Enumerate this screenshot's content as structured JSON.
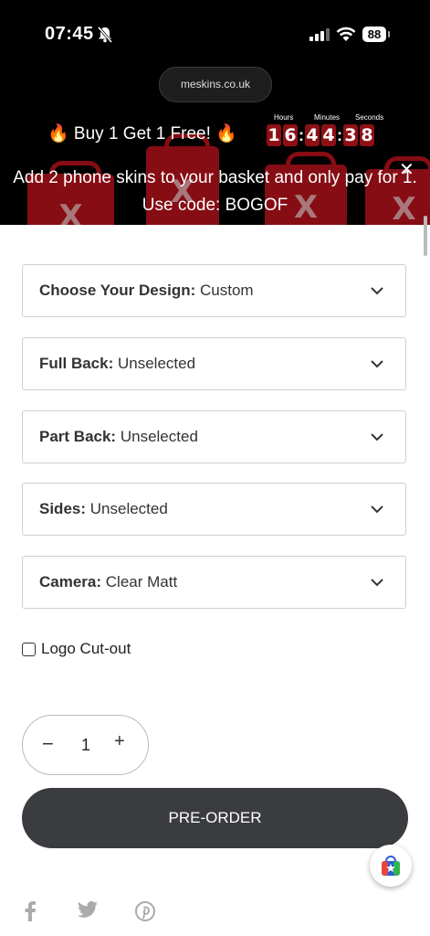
{
  "status_bar": {
    "time": "07:45",
    "battery": "88"
  },
  "browser": {
    "url": "meskins.co.uk"
  },
  "promo": {
    "headline": "🔥 Buy 1 Get 1 Free! 🔥",
    "countdown": {
      "labels": {
        "hours": "Hours",
        "minutes": "Minutes",
        "seconds": "Seconds"
      },
      "digits": [
        "1",
        "6",
        "4",
        "4",
        "3",
        "8"
      ]
    },
    "announcement": "Add 2 phone skins to your basket and only pay for 1. Use code: BOGOF",
    "close_icon": "close-icon",
    "accent": "#8e1014"
  },
  "options": [
    {
      "label": "Choose Your Design:",
      "value": "Custom"
    },
    {
      "label": "Full Back:",
      "value": "Unselected"
    },
    {
      "label": "Part Back:",
      "value": "Unselected"
    },
    {
      "label": "Sides:",
      "value": "Unselected"
    },
    {
      "label": "Camera:",
      "value": "Clear Matt"
    }
  ],
  "logo_cutout": {
    "label": "Logo Cut-out",
    "checked": false
  },
  "quantity": {
    "value": "1",
    "minus": "−",
    "plus": "+"
  },
  "preorder_button": "PRE-ORDER",
  "button_color": "#3a3c3f",
  "social_icons": [
    "facebook-icon",
    "twitter-icon",
    "pinterest-icon"
  ]
}
